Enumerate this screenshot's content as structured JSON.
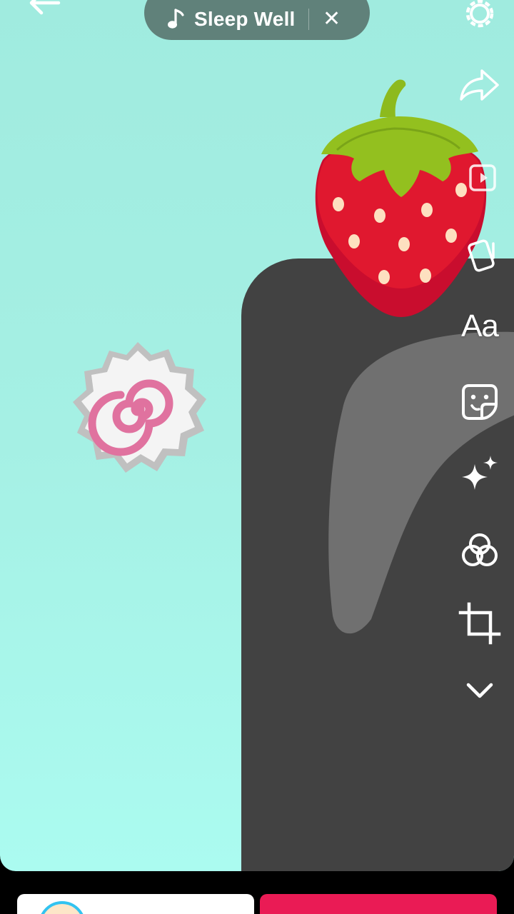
{
  "music": {
    "title": "Sleep Well",
    "close_symbol": "✕"
  },
  "toolbar": {
    "text_tool_label": "Aa",
    "items": [
      {
        "icon": "settings-gear-icon"
      },
      {
        "icon": "share-arrow-icon"
      },
      {
        "icon": "template-icon"
      },
      {
        "icon": "flip-icon"
      },
      {
        "icon": "text-icon"
      },
      {
        "icon": "sticker-icon"
      },
      {
        "icon": "effects-sparkle-icon"
      },
      {
        "icon": "filters-icon"
      },
      {
        "icon": "crop-icon"
      },
      {
        "icon": "chevron-down-icon"
      }
    ]
  },
  "canvas": {
    "background_colors": [
      "#a0ebdf",
      "#abfbf0"
    ],
    "stickers": [
      "naruto-fishcake-sticker",
      "strawberry-sticker"
    ]
  },
  "colors": {
    "accent": "#ea1b55",
    "dark_block": "#424242"
  }
}
